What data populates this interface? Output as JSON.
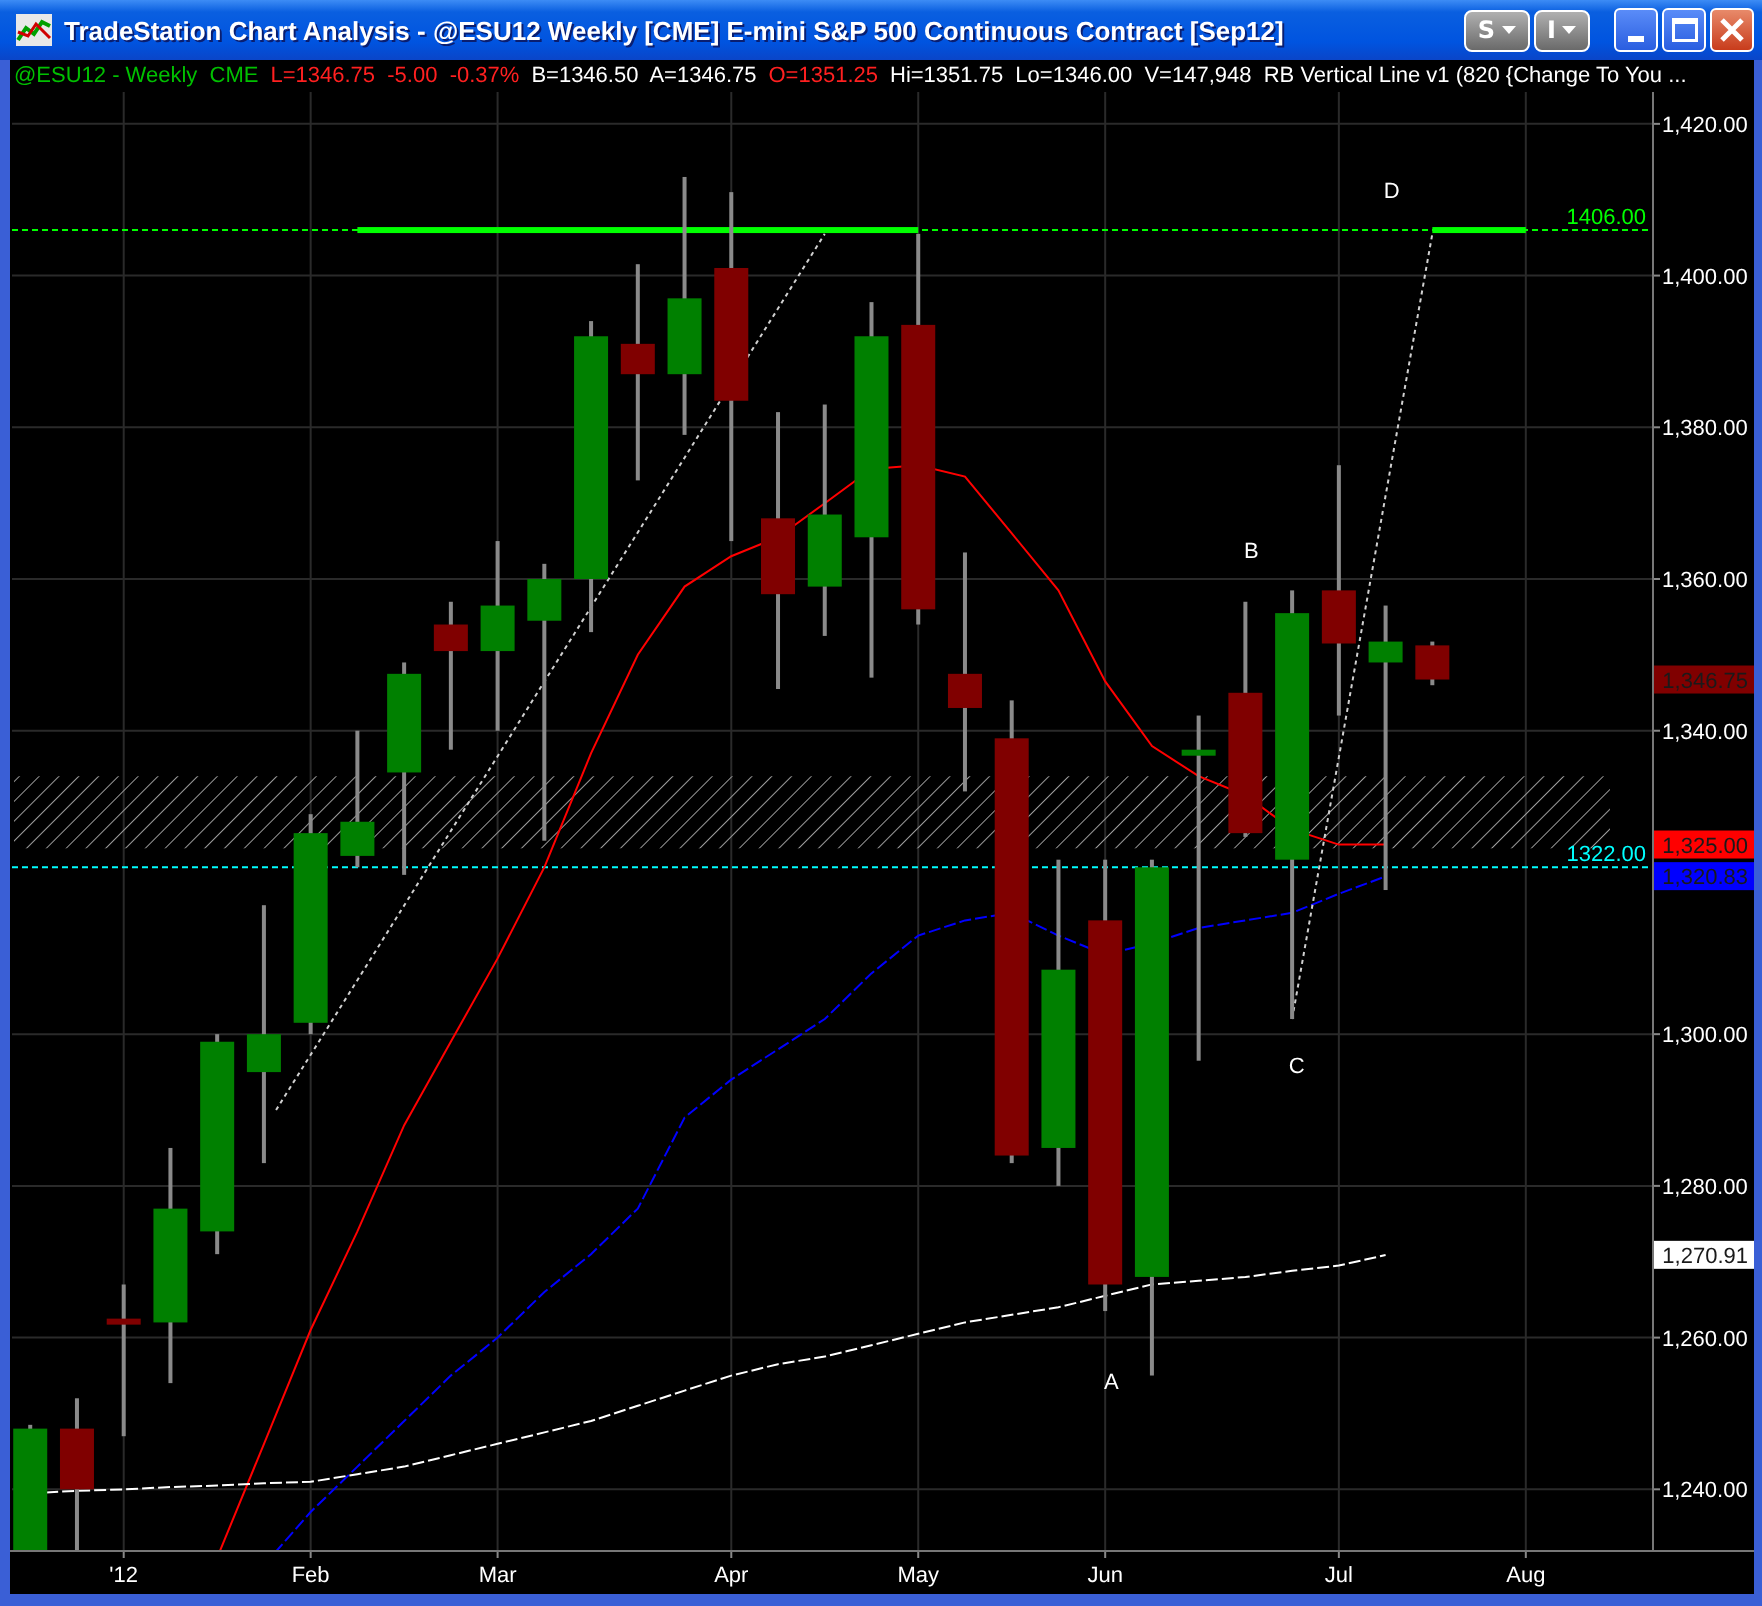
{
  "window": {
    "title": "TradeStation Chart Analysis - @ESU12 Weekly [CME] E-mini S&P 500 Continuous Contract [Sep12]"
  },
  "toolbar_buttons": [
    {
      "label": "S"
    },
    {
      "label": "I"
    }
  ],
  "info_line": [
    {
      "text": "@ESU12 - Weekly  CME",
      "color": "#00c000"
    },
    {
      "text": "L=1346.75  -5.00  -0.37%",
      "color": "#ff2020"
    },
    {
      "text": "B=1346.50  A=1346.75",
      "color": "#ffffff"
    },
    {
      "text": "O=1351.25",
      "color": "#ff2020"
    },
    {
      "text": "Hi=1351.75  Lo=1346.00  V=147,948  RB Vertical Line v1 (820 {Change To You ...",
      "color": "#ffffff"
    }
  ],
  "chart": {
    "price_axis_labels": [
      "1,420.00",
      "1,400.00",
      "1,380.00",
      "1,360.00",
      "1,340.00",
      "1,300.00",
      "1,280.00",
      "1,260.00",
      "1,240.00"
    ],
    "time_axis_labels": [
      "'12",
      "Feb",
      "Mar",
      "Apr",
      "May",
      "Jun",
      "Jul",
      "Aug"
    ],
    "level_labels": [
      {
        "text": "1406.00",
        "color": "#00ff00"
      },
      {
        "text": "1322.00",
        "color": "#00ffff"
      }
    ],
    "point_labels": [
      "A",
      "B",
      "C",
      "D"
    ],
    "price_tags": [
      {
        "text": "1,346.75",
        "color": "#800000"
      },
      {
        "text": "1,325.00",
        "color": "#ff0000"
      },
      {
        "text": "1,320.83",
        "color": "#0000ff"
      },
      {
        "text": "1,270.91",
        "color": "#ffffff"
      }
    ]
  }
}
